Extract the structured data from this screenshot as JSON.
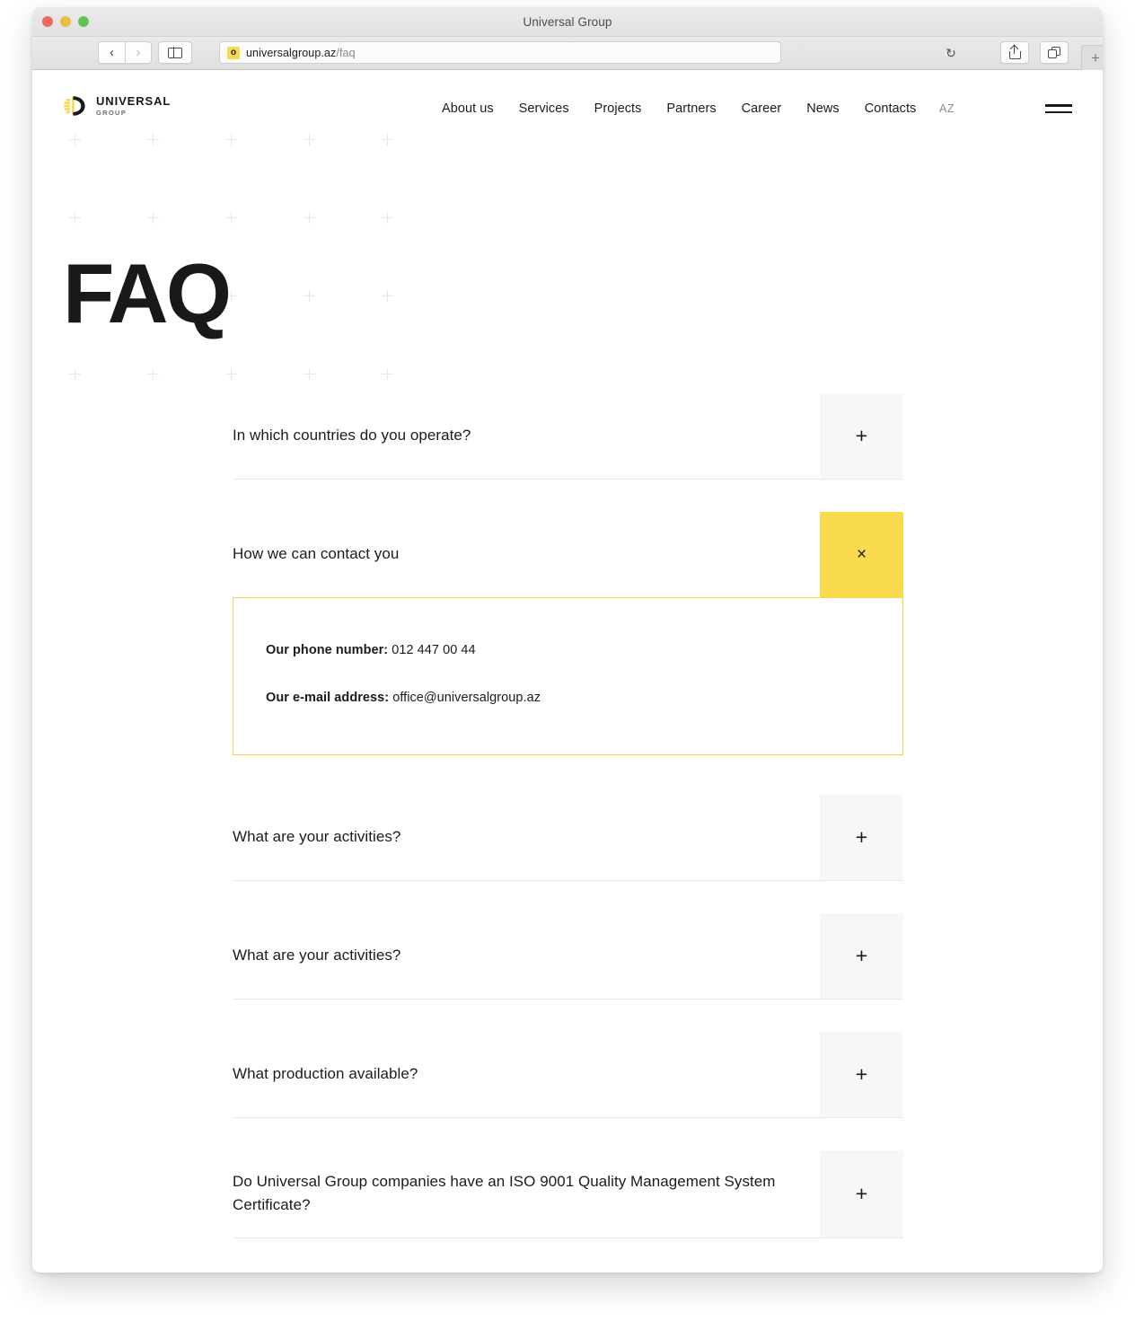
{
  "browser": {
    "window_title": "Universal Group",
    "url_domain": "universalgroup.az",
    "url_path": "/faq",
    "favicon_glyph": "o",
    "back_glyph": "‹",
    "forward_glyph": "›",
    "reload_glyph": "↻",
    "newtab_glyph": "+",
    "traffic_lights": [
      "close",
      "minimize",
      "zoom"
    ]
  },
  "site": {
    "logo": {
      "primary": "UNIVERSAL",
      "secondary": "GROUP",
      "accent_color": "#f6d94c"
    },
    "nav": [
      {
        "label": "About us"
      },
      {
        "label": "Services"
      },
      {
        "label": "Projects"
      },
      {
        "label": "Partners"
      },
      {
        "label": "Career"
      },
      {
        "label": "News"
      },
      {
        "label": "Contacts"
      }
    ],
    "language": "AZ",
    "page_title": "FAQ",
    "colors": {
      "accent_yellow": "#fbdb4e",
      "toggle_grey": "#f7f7f7",
      "text": "#1c1c1e",
      "divider": "#e9e9e9"
    }
  },
  "faq": {
    "items": [
      {
        "question": "In which countries do you operate?",
        "toggle_glyph": "+",
        "open": false
      },
      {
        "question": "How we can contact you",
        "toggle_glyph": "×",
        "open": true,
        "answer": [
          {
            "label": "Our phone number:",
            "value": " 012 447 00 44"
          },
          {
            "label": "Our e-mail address:",
            "value": " office@universalgroup.az"
          }
        ]
      },
      {
        "question": "What are your activities?",
        "toggle_glyph": "+",
        "open": false
      },
      {
        "question": "What are your activities?",
        "toggle_glyph": "+",
        "open": false
      },
      {
        "question": "What production available?",
        "toggle_glyph": "+",
        "open": false
      },
      {
        "question": "Do Universal Group companies have an ISO 9001 Quality Management System Certificate?",
        "toggle_glyph": "+",
        "open": false
      }
    ]
  }
}
